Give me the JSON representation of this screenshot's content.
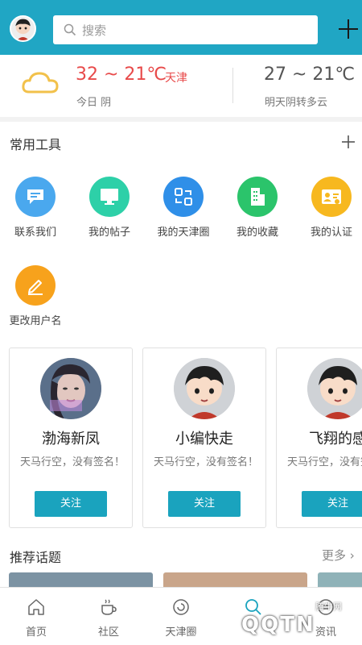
{
  "header": {
    "search_placeholder": "搜索",
    "icons": {
      "avatar": "cartoon-avatar",
      "search": "search-icon",
      "add": "plus-icon"
    }
  },
  "weather": {
    "today_temp": "32 ~ 21℃",
    "city": "天津",
    "today_label": "今日 阴",
    "tomorrow_temp": "27 ~ 21℃",
    "tomorrow_label": "明天阴转多云"
  },
  "tools": {
    "title": "常用工具",
    "items": [
      {
        "label": "联系我们",
        "icon": "chat-icon",
        "color": "#4aa8ee"
      },
      {
        "label": "我的帖子",
        "icon": "monitor-icon",
        "color": "#2dd0a8"
      },
      {
        "label": "我的天津圈",
        "icon": "circle-refresh-icon",
        "color": "#2f8fe8"
      },
      {
        "label": "我的收藏",
        "icon": "building-icon",
        "color": "#2bc46b"
      },
      {
        "label": "我的认证",
        "icon": "id-card-icon",
        "color": "#f7b81f"
      },
      {
        "label": "更改用户名",
        "icon": "pencil-icon",
        "color": "#f7a21c"
      }
    ]
  },
  "users": [
    {
      "name": "渤海新凤",
      "signature": "天马行空，没有签名！",
      "follow_label": "关注",
      "avatar": "photo-avatar"
    },
    {
      "name": "小编快走",
      "signature": "天马行空，没有签名！",
      "follow_label": "关注",
      "avatar": "cartoon-avatar"
    },
    {
      "name": "飞翔的感",
      "signature": "天马行空，没有签名！",
      "follow_label": "关注",
      "avatar": "cartoon-avatar"
    }
  ],
  "topics": {
    "title": "推荐话题",
    "more_label": "更多"
  },
  "nav": [
    {
      "label": "首页",
      "icon": "home-icon"
    },
    {
      "label": "社区",
      "icon": "cup-icon"
    },
    {
      "label": "天津圈",
      "icon": "refresh-circle-icon"
    },
    {
      "label": "",
      "icon": "search-icon"
    },
    {
      "label": "资讯",
      "icon": "message-icon"
    }
  ],
  "watermark": {
    "text": "QQTN",
    "small": "腾牛网"
  },
  "colors": {
    "accent": "#1aa3be",
    "header": "#20a6c4",
    "warm": "#e84a4a"
  }
}
